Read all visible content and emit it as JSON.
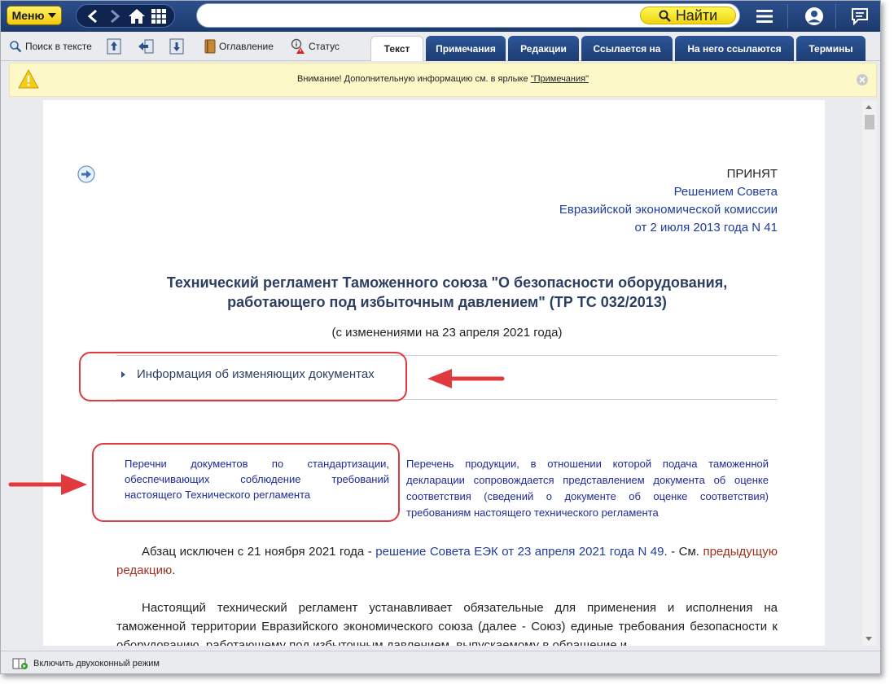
{
  "topbar": {
    "menu_label": "Меню",
    "search_value": "",
    "find_label": "Найти",
    "icons": [
      "back-icon",
      "forward-icon",
      "home-icon",
      "grid-icon",
      "hamburger-icon",
      "user-icon",
      "chat-icon"
    ]
  },
  "toolbar": {
    "search_in_text": "Поиск в тексте",
    "contents": "Оглавление",
    "status": "Статус",
    "tabs": [
      {
        "label": "Текст",
        "active": true
      },
      {
        "label": "Примечания"
      },
      {
        "label": "Редакции"
      },
      {
        "label": "Ссылается на"
      },
      {
        "label": "На него ссылаются"
      },
      {
        "label": "Термины"
      }
    ]
  },
  "warning": {
    "text": "Внимание! Дополнительную информацию см. в ярлыке",
    "link": "\"Примечания\""
  },
  "document": {
    "accepted": "ПРИНЯТ",
    "accepted_by_1": "Решением Совета",
    "accepted_by_2": "Евразийской экономической комиссии",
    "accepted_date": "от 2 июля 2013 года N 41",
    "title_1": "Технический регламент Таможенного союза \"О безопасности оборудования,",
    "title_2": "работающего под избыточным давлением\" (ТР ТС 032/2013)",
    "subtitle": "(с изменениями на 23 апреля 2021 года)",
    "info_link": "Информация об изменяющих документах",
    "left_col": "Перечни документов по стандартизации, обеспечивающих соблюдение требований настоящего Технического регламента",
    "right_col": "Перечень продукции, в отношении которой подача таможенной декларации сопровождается представлением документа об оценке соответствия (сведений о документе об оценке соответствия) требованиям настоящего технического регламента",
    "p1_a": "Абзац исключен с 21 ноября 2021 года - ",
    "p1_link": "решение Совета ЕЭК от 23 апреля 2021 года N 49",
    "p1_b": ". - См. ",
    "p1_red": "предыдущую редакцию",
    "p1_c": ".",
    "p2": "Настоящий технический регламент устанавливает обязательные для применения и исполнения на таможенной территории Евразийского экономического союза (далее - Союз) единые требования безопасности к оборудованию, работающему под избыточным давлением, выпускаемому в обращение и"
  },
  "statusbar": {
    "dual_window": "Включить двухоконный режим"
  }
}
